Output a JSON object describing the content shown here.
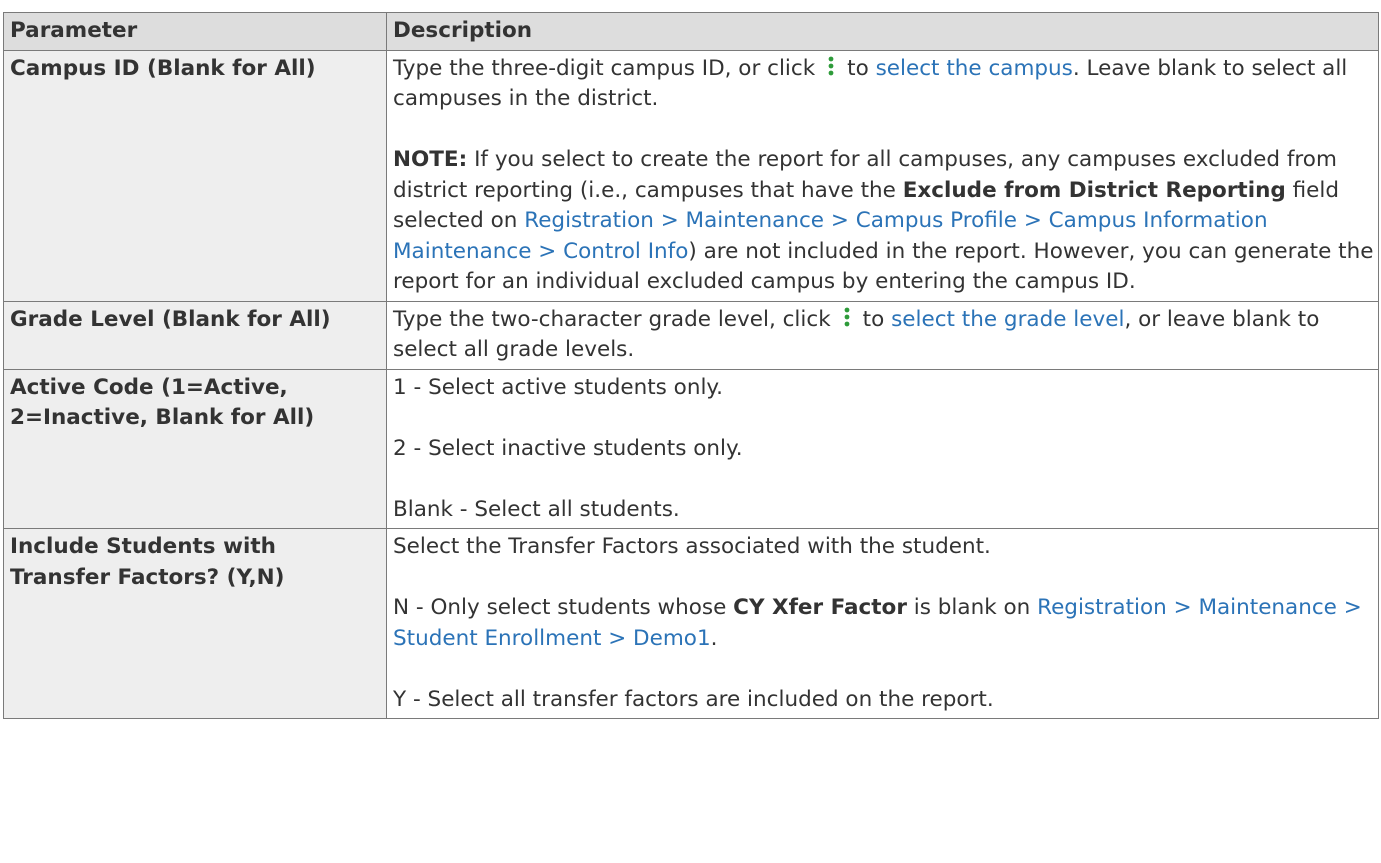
{
  "header": {
    "parameter": "Parameter",
    "description": "Description"
  },
  "row_campus": {
    "param": "Campus ID (Blank for All)",
    "p1_a": "Type the three-digit campus ID, or click",
    "p1_b": "to",
    "p1_link": "select the campus",
    "p1_c": ". Leave blank to select all campuses in the district.",
    "note_label": "NOTE:",
    "note_a": " If you select to create the report for all campuses, any campuses excluded from district reporting (i.e., campuses that have the ",
    "note_bold": "Exclude from District Reporting",
    "note_b": " field selected on ",
    "note_link": "Registration > Maintenance > Campus Profile > Campus Information Maintenance > Control Info",
    "note_c": ") are not included in the report. However, you can generate the report for an individual excluded campus by entering the campus ID."
  },
  "row_grade": {
    "param": "Grade Level (Blank for All)",
    "a": "Type the two-character grade level, click",
    "b": "to",
    "link": "select the grade level",
    "c": ", or leave blank to select all grade levels."
  },
  "row_active": {
    "param": "Active Code (1=Active, 2=Inactive, Blank for All)",
    "l1": "1 - Select active students only.",
    "l2": "2 - Select inactive students only.",
    "l3": "Blank - Select all students."
  },
  "row_transfer": {
    "param": "Include Students with Transfer Factors? (Y,N)",
    "l1": "Select the Transfer Factors associated with the student.",
    "n_a": "N - Only select students whose ",
    "n_bold": "CY Xfer Factor",
    "n_b": " is blank on ",
    "n_link": "Registration > Maintenance > Student Enrollment > Demo1",
    "n_c": ".",
    "l3": "Y - Select all transfer factors are included on the report."
  },
  "colors": {
    "link": "#2b73b7",
    "header_bg": "#dddddd",
    "param_bg": "#eeeeee",
    "kebab_green": "#2e9b3a"
  }
}
